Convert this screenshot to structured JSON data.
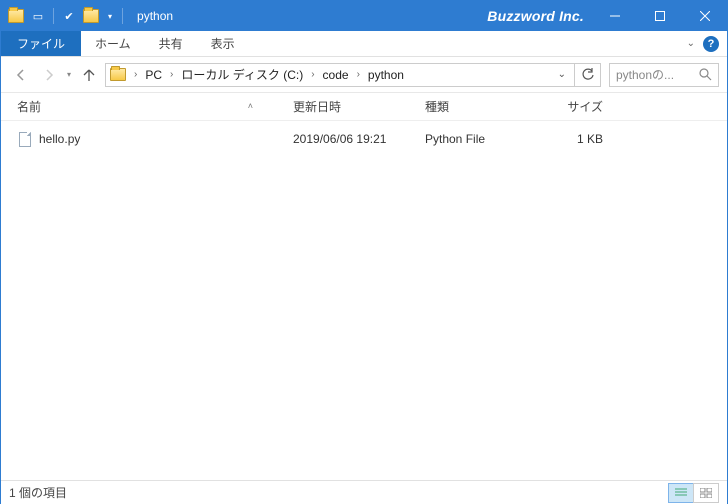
{
  "title": "python",
  "brand": "Buzzword Inc.",
  "tabs": {
    "file": "ファイル",
    "home": "ホーム",
    "share": "共有",
    "view": "表示"
  },
  "breadcrumb": [
    "PC",
    "ローカル ディスク (C:)",
    "code",
    "python"
  ],
  "search": {
    "placeholder": "pythonの..."
  },
  "columns": {
    "name": "名前",
    "date": "更新日時",
    "type": "種類",
    "size": "サイズ"
  },
  "files": [
    {
      "name": "hello.py",
      "date": "2019/06/06 19:21",
      "type": "Python File",
      "size": "1 KB"
    }
  ],
  "status": "1 個の項目"
}
